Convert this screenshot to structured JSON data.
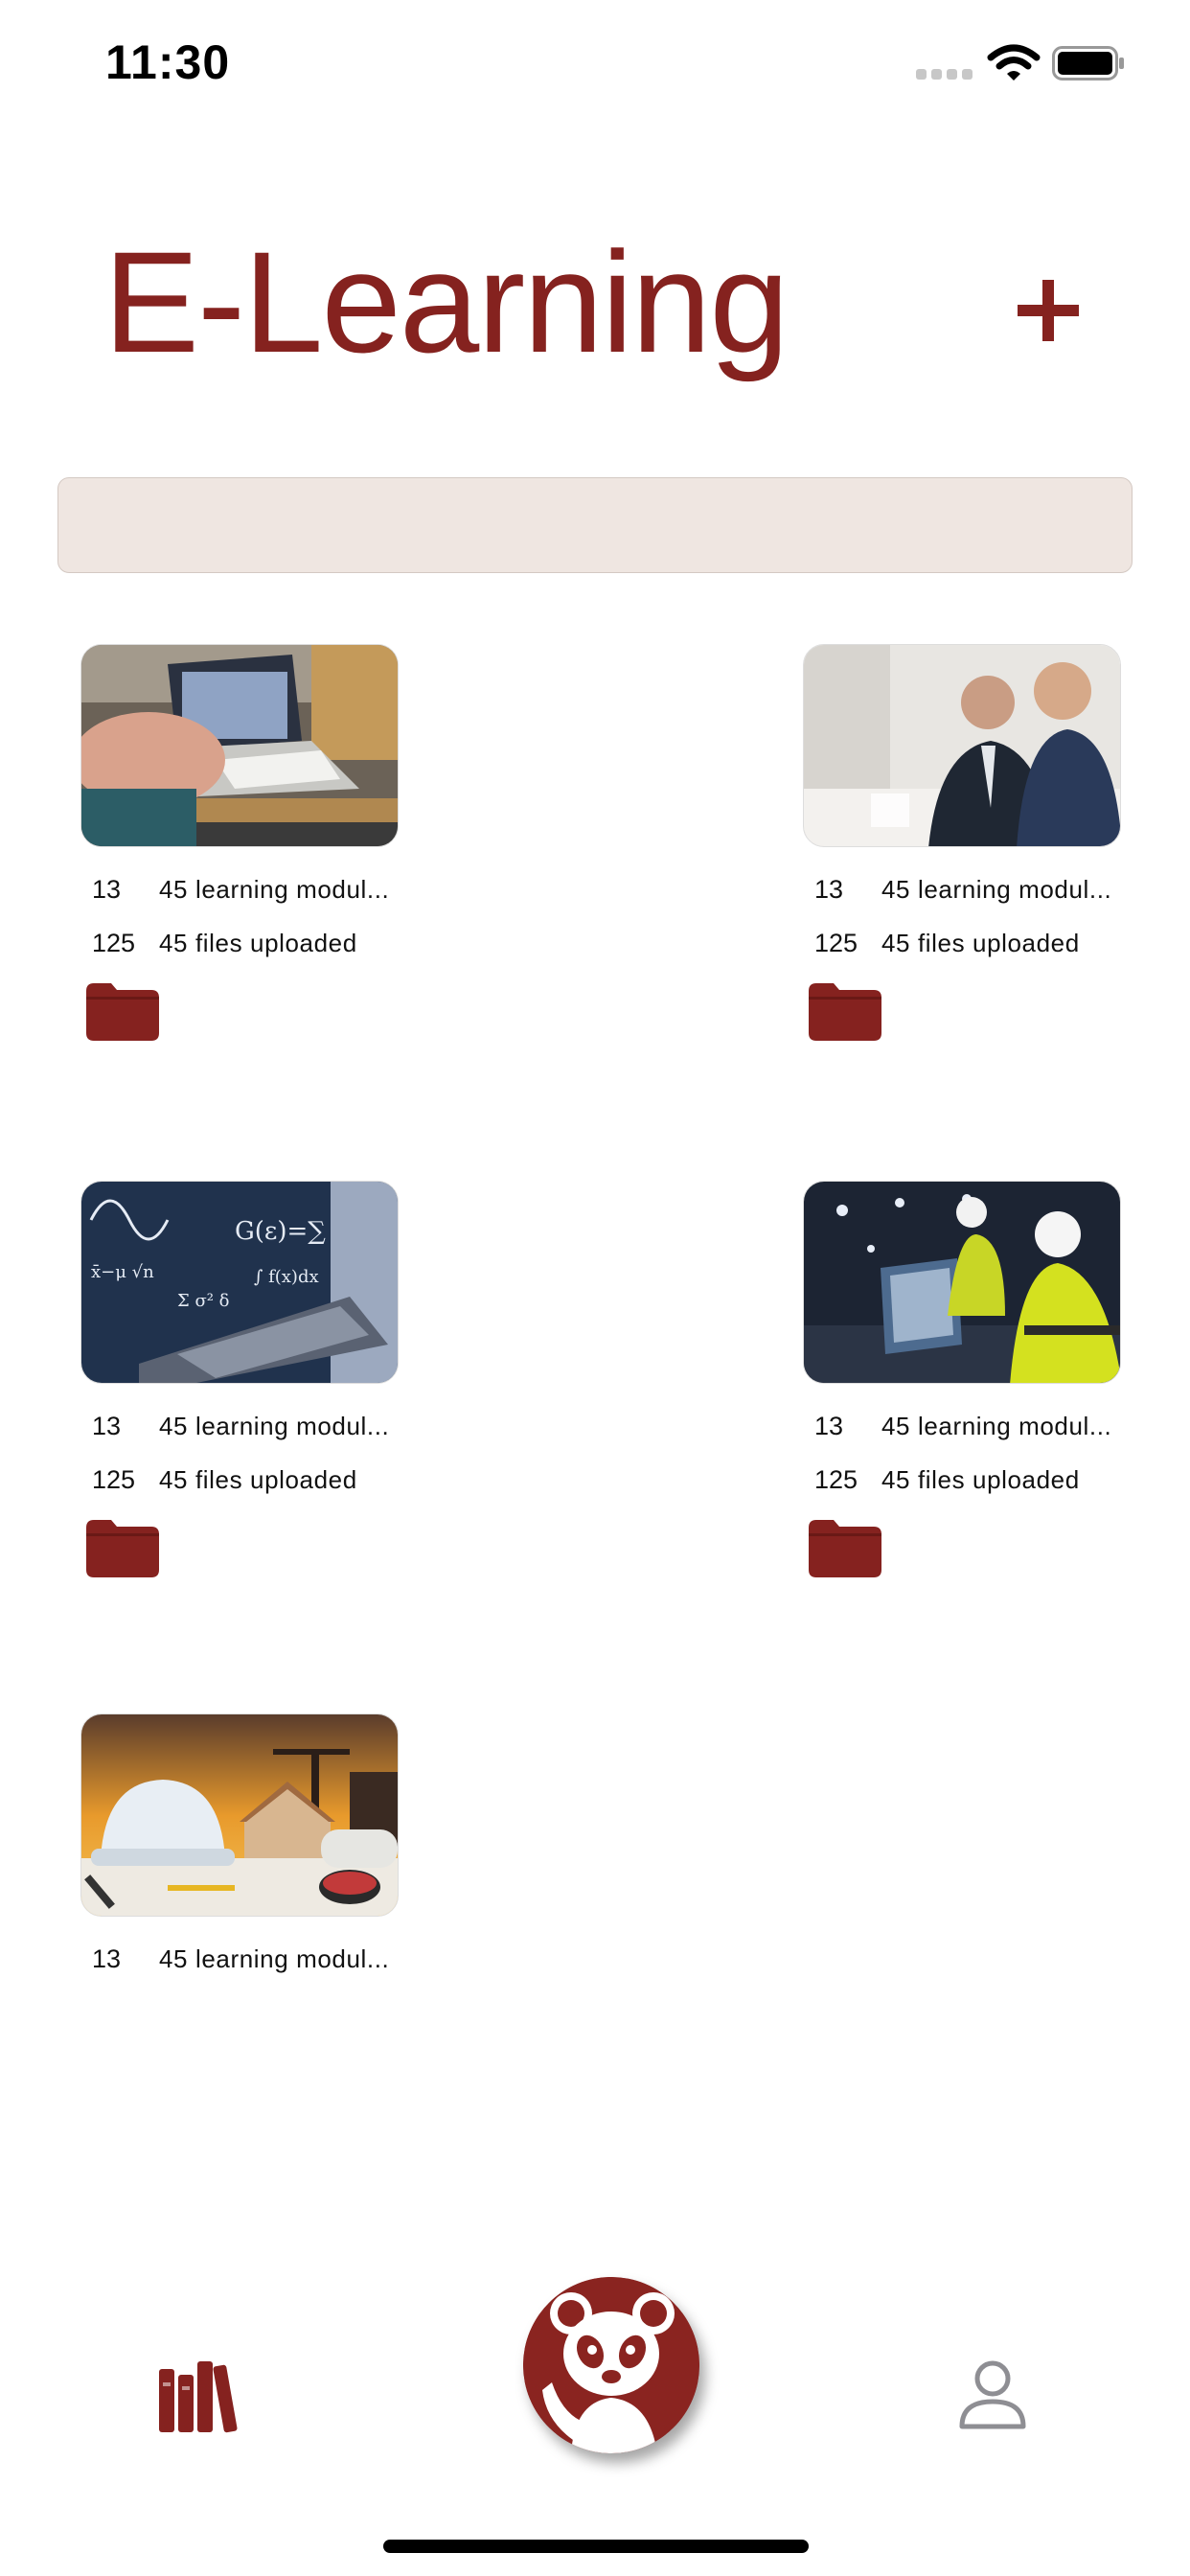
{
  "status_bar": {
    "time": "11:30"
  },
  "header": {
    "title": "E-Learning",
    "add_icon": "plus-icon"
  },
  "search": {
    "placeholder": ""
  },
  "colors": {
    "brand": "#85221f",
    "search_bg": "#efe6e1"
  },
  "cards": [
    {
      "modules_count": "13",
      "modules_text": "45 learning modul...",
      "files_count": "125",
      "files_text": "45 files uploaded",
      "image": "laptop-classroom-photo",
      "has_folder": true
    },
    {
      "modules_count": "13",
      "modules_text": "45 learning modul...",
      "files_count": "125",
      "files_text": "45 files uploaded",
      "image": "business-meeting-photo",
      "has_folder": true
    },
    {
      "modules_count": "13",
      "modules_text": "45 learning modul...",
      "files_count": "125",
      "files_text": "45 files uploaded",
      "image": "math-formulas-laptop-photo",
      "has_folder": true
    },
    {
      "modules_count": "13",
      "modules_text": "45 learning modul...",
      "files_count": "125",
      "files_text": "45 files uploaded",
      "image": "factory-engineers-photo",
      "has_folder": true
    },
    {
      "modules_count": "13",
      "modules_text": "45 learning modul...",
      "image": "construction-helmet-photo",
      "has_folder": false
    }
  ],
  "bottom_nav": {
    "left_icon": "library-icon",
    "center_icon": "panda-logo",
    "right_icon": "profile-icon"
  }
}
